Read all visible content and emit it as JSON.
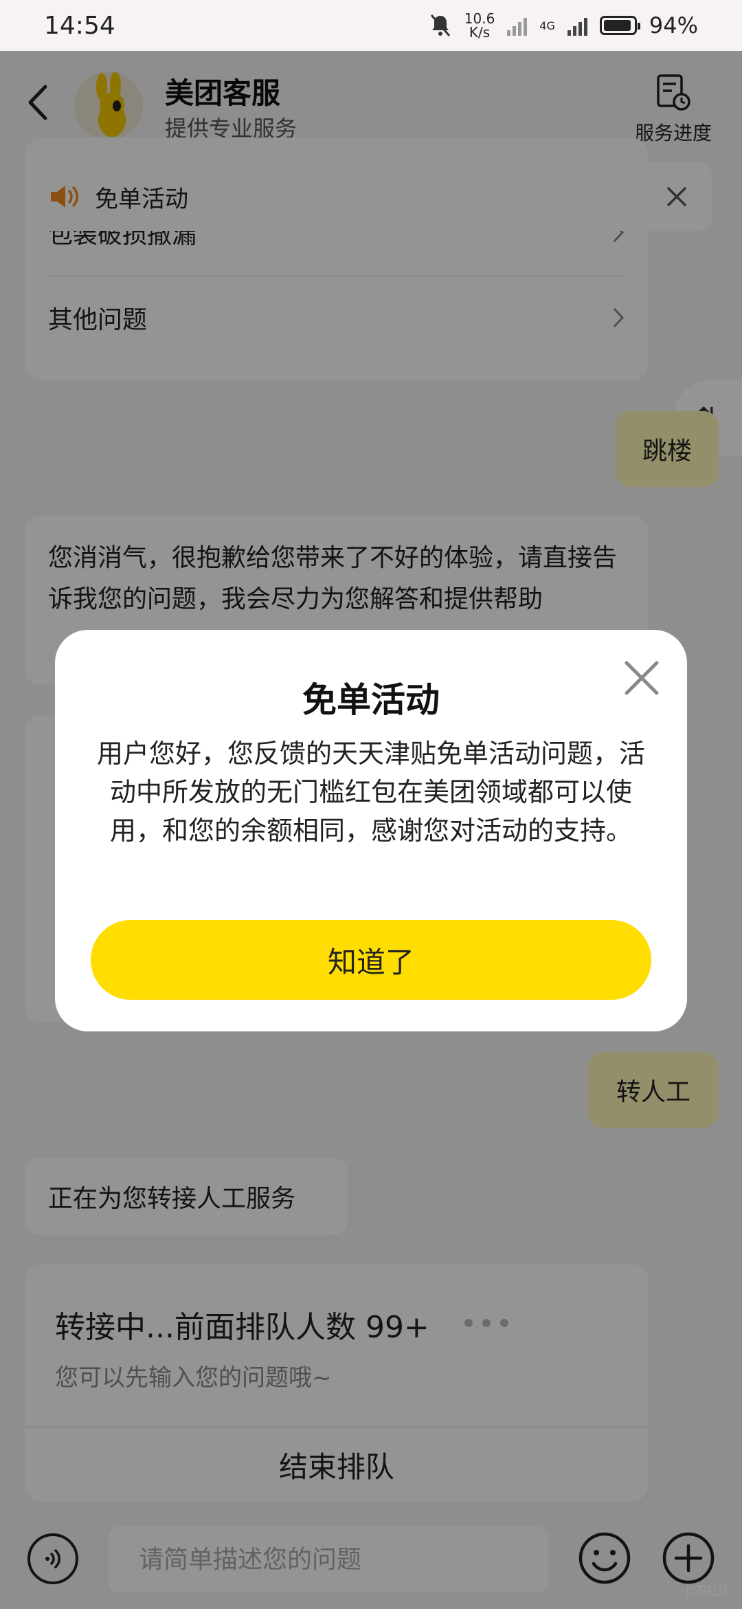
{
  "status_bar": {
    "time": "14:54",
    "net_speed_value": "10.6",
    "net_speed_unit": "K/s",
    "network_type": "4G",
    "battery": "94%"
  },
  "header": {
    "title": "美团客服",
    "subtitle": "提供专业服务",
    "progress_label": "服务进度"
  },
  "notice": {
    "text": "免单活动"
  },
  "chat": {
    "menu_items": [
      {
        "label": "包装破损撒漏"
      },
      {
        "label": "其他问题"
      }
    ],
    "side_button": "⇅",
    "user_msg_1": "跳楼",
    "bot_msg_1": "您消消气，很抱歉给您带来了不好的体验，请直接告诉我您的问题，我会尽力为您解答和提供帮助",
    "user_msg_2": "转人工",
    "bot_msg_2": "正在为您转接人工服务",
    "queue": {
      "title": "转接中...前面排队人数 99+",
      "subtitle": "您可以先输入您的问题哦~",
      "end_label": "结束排队"
    }
  },
  "input": {
    "placeholder": "请简单描述您的问题"
  },
  "watermark": "卡农社区",
  "modal": {
    "title": "免单活动",
    "body": "用户您好，您反馈的天天津贴免单活动问题，活动中所发放的无门槛红包在美团领域都可以使用，和您的余额相同，感谢您对活动的支持。",
    "button": "知道了"
  },
  "colors": {
    "accent_yellow": "#ffdd00",
    "user_bubble": "#fff7b8",
    "overlay": "rgba(0,0,0,0.42)"
  }
}
